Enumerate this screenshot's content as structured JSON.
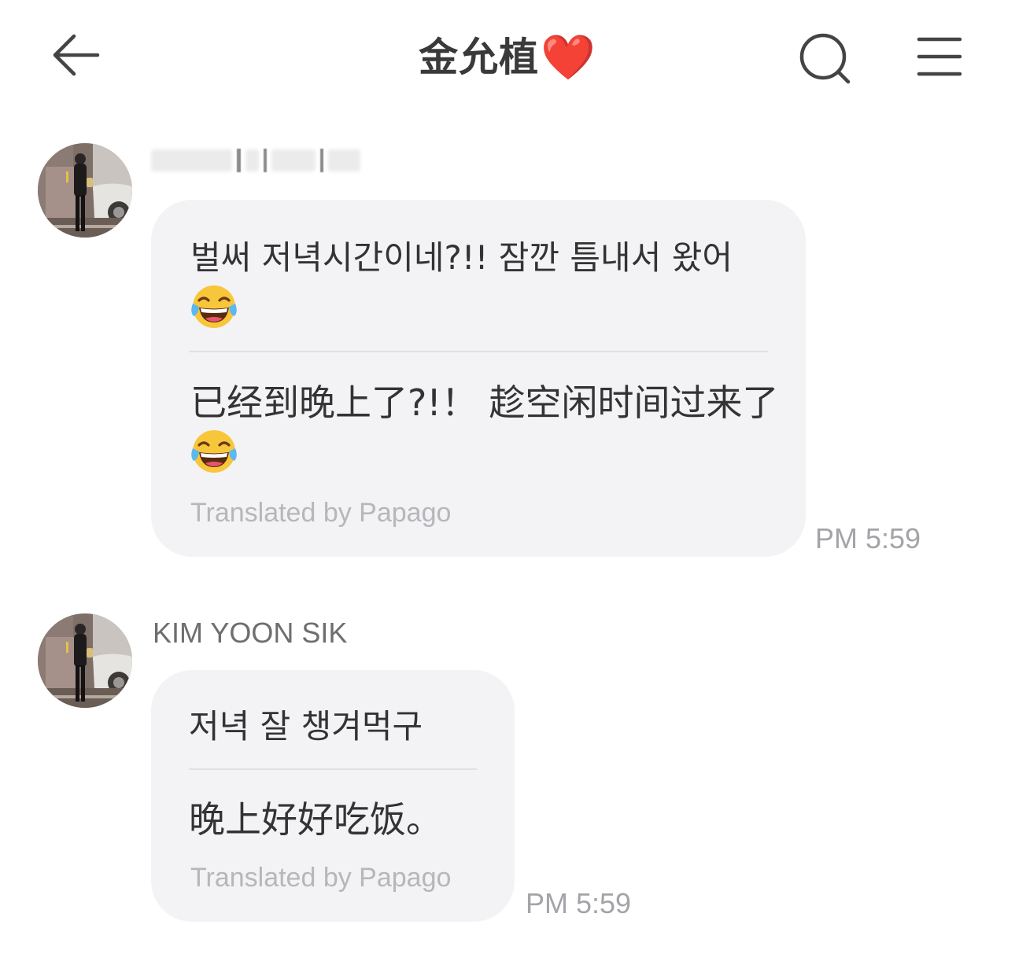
{
  "header": {
    "back_icon": "arrow-left-icon",
    "title": "金允植",
    "title_emoji": "❤️",
    "search_icon": "search-icon",
    "menu_icon": "menu-icon"
  },
  "messages": [
    {
      "sender": "",
      "sender_obscured": true,
      "avatar_icon": "avatar-photo",
      "original_text": "벌써 저녁시간이네?!! 잠깐 틈내서 왔어",
      "original_emoji": "😂",
      "translated_text": "已经到晚上了?!！ 趁空闲时间过来了",
      "translated_emoji": "😂",
      "translation_credit": "Translated by Papago",
      "time": "PM 5:59"
    },
    {
      "sender": "KIM YOON SIK",
      "sender_obscured": false,
      "avatar_icon": "avatar-photo",
      "original_text": "저녁 잘 챙겨먹구",
      "translated_text": "晚上好好吃饭。",
      "translation_credit": "Translated by Papago",
      "time": "PM 5:59"
    }
  ],
  "colors": {
    "bubble": "#f3f3f5",
    "heart": "#e0252b",
    "meta_text": "#a4a4a8"
  }
}
